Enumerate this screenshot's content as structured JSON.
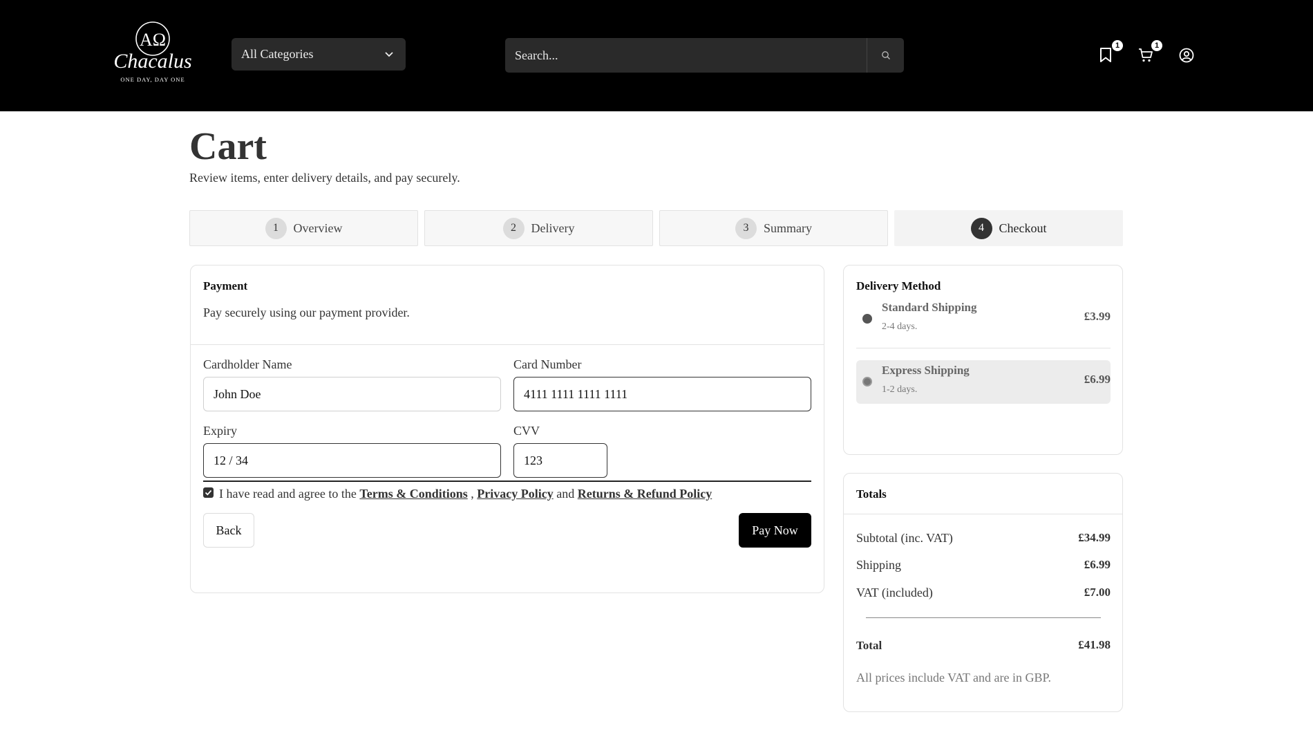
{
  "header": {
    "logo_text": "Chacalus",
    "logo_monogram": "AΩ",
    "logo_tagline": "ONE DAY, DAY ONE",
    "category_select": "All Categories",
    "search_placeholder": "Search...",
    "wishlist_count": "1",
    "cart_count": "1"
  },
  "page": {
    "title": "Cart",
    "subtitle": "Review items, enter delivery details, and pay securely."
  },
  "steps": [
    {
      "num": "1",
      "label": "Overview"
    },
    {
      "num": "2",
      "label": "Delivery"
    },
    {
      "num": "3",
      "label": "Summary"
    },
    {
      "num": "4",
      "label": "Checkout"
    }
  ],
  "payment": {
    "heading": "Payment",
    "description": "Pay securely using our payment provider.",
    "cardholder_label": "Cardholder Name",
    "cardholder_value": "John Doe",
    "card_number_label": "Card Number",
    "card_number_value": "4111 1111 1111 1111",
    "expiry_label": "Expiry",
    "expiry_value": "12 / 34",
    "cvv_label": "CVV",
    "cvv_value": "123",
    "agree_prefix": "I have read and agree to the",
    "terms_link": "Terms & Conditions",
    "comma": ",",
    "privacy_link": "Privacy Policy",
    "and": "and",
    "returns_link": "Returns & Refund Policy",
    "back_label": "Back",
    "pay_label": "Pay Now"
  },
  "delivery": {
    "heading": "Delivery Method",
    "options": [
      {
        "name": "Standard Shipping",
        "days": "2-4 days.",
        "price": "£3.99"
      },
      {
        "name": "Express Shipping",
        "days": "1-2 days.",
        "price": "£6.99"
      }
    ]
  },
  "totals": {
    "heading": "Totals",
    "subtotal_label": "Subtotal (inc. VAT)",
    "subtotal_value": "£34.99",
    "shipping_label": "Shipping",
    "shipping_value": "£6.99",
    "vat_label": "VAT (included)",
    "vat_value": "£7.00",
    "total_label": "Total",
    "total_value": "£41.98",
    "note": "All prices include VAT and are in GBP."
  },
  "colors": {
    "header_bg": "#000000",
    "active_step": "#333333",
    "pay_button": "#000000"
  }
}
